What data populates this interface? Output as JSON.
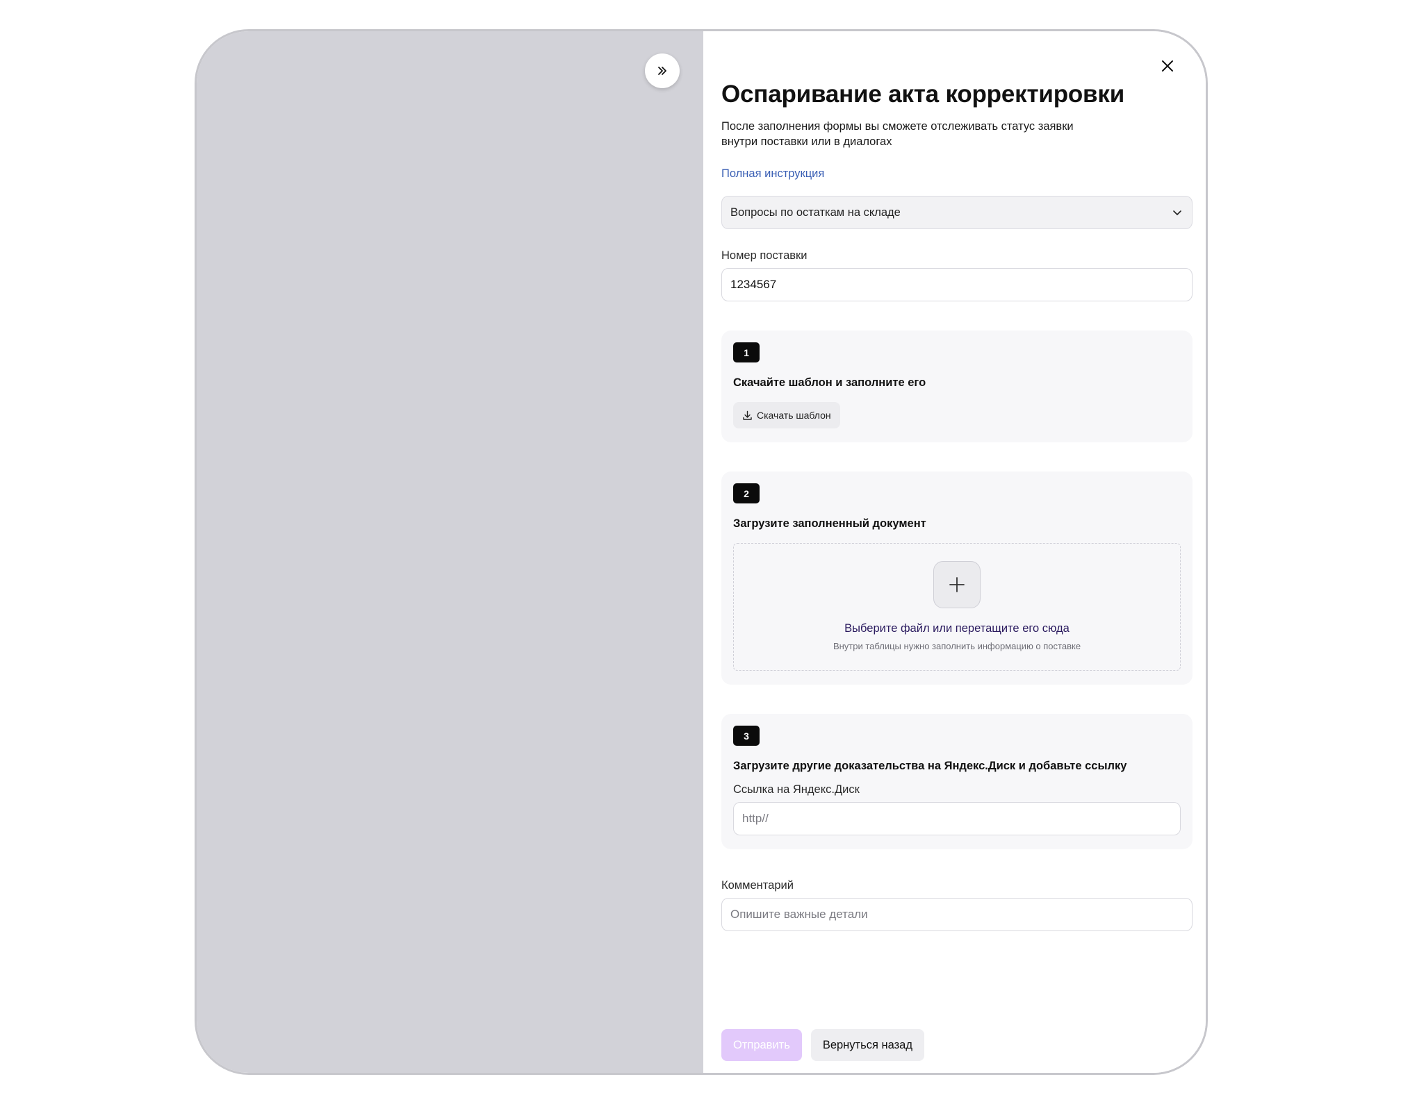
{
  "dialog": {
    "title": "Оспаривание акта корректировки",
    "subtitle": "После заполнения формы вы сможете отслеживать статус заявки внутри поставки или в диалогах",
    "instruction_link": "Полная инструкция",
    "topic_select": {
      "value": "Вопросы по остаткам на складе"
    },
    "supply_number": {
      "label": "Номер поставки",
      "value": "1234567"
    }
  },
  "steps": [
    {
      "number": "1",
      "title": "Скачайте шаблон и заполните его",
      "button_label": "Скачать шаблон"
    },
    {
      "number": "2",
      "title": "Загрузите заполненный документ",
      "dropzone_title": "Выберите файл или перетащите его сюда",
      "dropzone_hint": "Внутри таблицы нужно заполнить информацию о поставке"
    },
    {
      "number": "3",
      "title": "Загрузите другие доказательства на Яндекс.Диск и добавьте ссылку",
      "field_label": "Ссылка на Яндекс.Диск",
      "field_placeholder": "http//"
    }
  ],
  "comment": {
    "label": "Комментарий",
    "placeholder": "Опишите важные детали"
  },
  "footer": {
    "submit_label": "Отправить",
    "back_label": "Вернуться назад"
  },
  "icons": {
    "collapse": "double-chevron-right-icon",
    "close": "close-icon",
    "dropdown": "chevron-down-icon",
    "download": "download-icon",
    "add": "plus-icon"
  },
  "colors": {
    "overlay": "#d2d2d8",
    "link": "#3a5fb4",
    "submit_disabled": "#e2c9fb",
    "step_badge": "#0b0b0b"
  }
}
